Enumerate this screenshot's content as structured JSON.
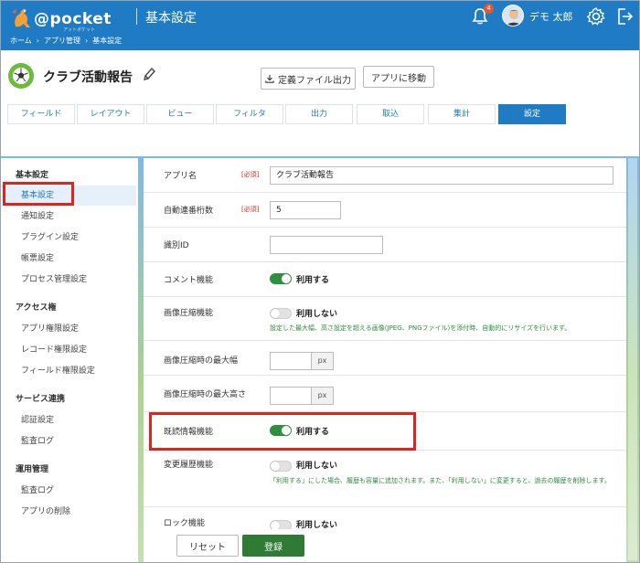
{
  "header": {
    "logo_text": "@pocket",
    "logo_sub": "アットポケット",
    "page_title": "基本設定",
    "breadcrumb": [
      "ホーム",
      "アプリ管理",
      "基本設定"
    ],
    "breadcrumb_sep": "›",
    "notification_count": "4",
    "user_name": "デモ 太郎"
  },
  "app": {
    "title": "クラブ活動報告",
    "export_button": "定義ファイル出力",
    "goto_button": "アプリに移動"
  },
  "tabs": [
    {
      "label": "フィールド"
    },
    {
      "label": "レイアウト"
    },
    {
      "label": "ビュー"
    },
    {
      "label": "フィルタ"
    },
    {
      "label": "出力"
    },
    {
      "label": "取込"
    },
    {
      "label": "集計"
    },
    {
      "label": "設定",
      "active": true
    }
  ],
  "sidebar": {
    "sections": [
      {
        "title": "基本設定",
        "items": [
          "基本設定",
          "通知設定",
          "プラグイン設定",
          "帳票設定",
          "プロセス管理設定"
        ]
      },
      {
        "title": "アクセス権",
        "items": [
          "アプリ権限設定",
          "レコード権限設定",
          "フィールド権限設定"
        ]
      },
      {
        "title": "サービス連携",
        "items": [
          "認証設定",
          "監査ログ"
        ]
      },
      {
        "title": "運用管理",
        "items": [
          "監査ログ",
          "アプリの削除"
        ]
      }
    ]
  },
  "form": {
    "required_label": "[必須]",
    "app_name_label": "アプリ名",
    "app_name_value": "クラブ活動報告",
    "auto_number_label": "自動連番桁数",
    "auto_number_value": "5",
    "identifier_label": "識別ID",
    "identifier_value": "",
    "comment_label": "コメント機能",
    "comment_state": "利用する",
    "image_compress_label": "画像圧縮機能",
    "image_compress_state": "利用しない",
    "image_compress_help": "設定した最大幅、高さ設定を超える画像(JPEG、PNGファイル)を添付時、自動的にリサイズを行います。",
    "max_width_label": "画像圧縮時の最大幅",
    "max_height_label": "画像圧縮時の最大高さ",
    "px_unit": "px",
    "read_info_label": "既読情報機能",
    "read_info_state": "利用する",
    "history_label": "変更履歴機能",
    "history_state": "利用しない",
    "history_help": "「利用する」にした場合、履歴も容量に追加されます。また、「利用しない」に変更すると、過去の履歴を削除します。",
    "lock_label": "ロック機能",
    "lock_state": "利用しない"
  },
  "footer": {
    "reset_button": "リセット",
    "save_button": "登録"
  },
  "colors": {
    "header_blue": "#1e7bc4",
    "toggle_on": "#2f8f3f",
    "highlight_red": "#e0241d",
    "save_green": "#2f7a35"
  }
}
